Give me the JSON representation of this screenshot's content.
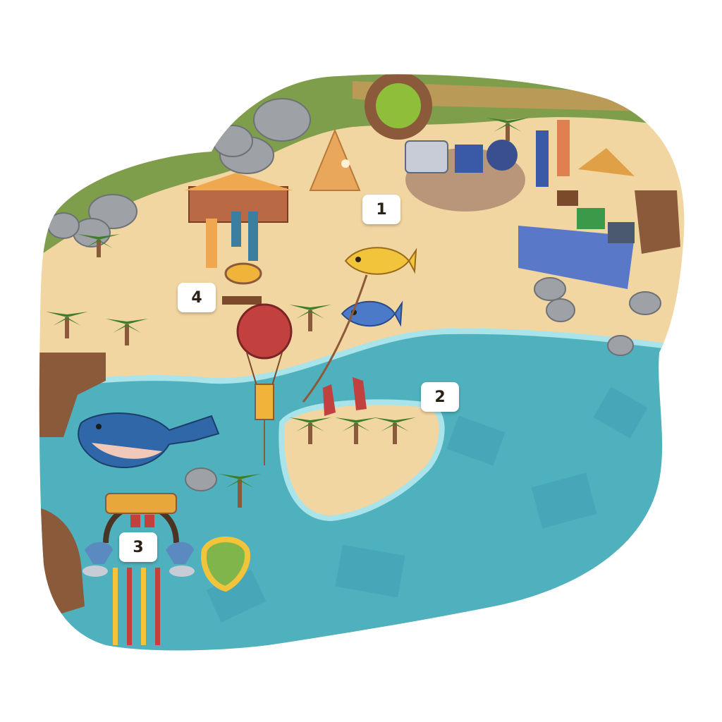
{
  "map": {
    "markers": [
      {
        "id": "1",
        "label": "1"
      },
      {
        "id": "2",
        "label": "2"
      },
      {
        "id": "3",
        "label": "3"
      },
      {
        "id": "4",
        "label": "4"
      }
    ]
  },
  "colors": {
    "sand": "#f2d6a2",
    "water": "#4fb1bd",
    "water_deep": "#3a93ab",
    "grass": "#7e9e4c",
    "rock": "#a7a9ad",
    "path": "#8b5a3a",
    "marker_bg": "#ffffff",
    "marker_text": "#2a2119"
  },
  "icons": [
    "palm-tree-icon",
    "fish-kite-icon",
    "hot-air-balloon-icon",
    "whale-icon",
    "dolphin-statue-icon",
    "tent-icon",
    "beach-house-icon",
    "market-stall-icon"
  ]
}
